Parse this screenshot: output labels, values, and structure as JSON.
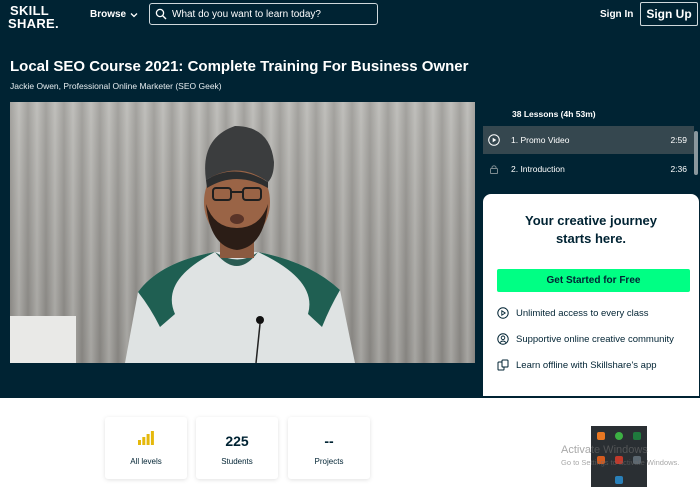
{
  "nav": {
    "logo_line1": "SKILL",
    "logo_line2": "SHARE.",
    "browse_label": "Browse",
    "search_placeholder": "What do you want to learn today?",
    "signin_label": "Sign In",
    "signup_label": "Sign Up"
  },
  "course": {
    "title": "Local SEO Course 2021: Complete Training For Business Owner",
    "author": "Jackie Owen, Professional Online Marketer (SEO Geek)"
  },
  "lessons": {
    "header": "38 Lessons (4h 53m)",
    "items": [
      {
        "name": "1. Promo Video",
        "duration": "2:59",
        "icon": "play-icon"
      },
      {
        "name": "2. Introduction",
        "duration": "2:36",
        "icon": "lock-icon"
      }
    ]
  },
  "card": {
    "headline_line1": "Your creative journey",
    "headline_line2": "starts here.",
    "cta_label": "Get Started for Free",
    "features": [
      {
        "text": "Unlimited access to every class",
        "icon": "play-circle-icon"
      },
      {
        "text": "Supportive online creative community",
        "icon": "user-icon"
      },
      {
        "text": "Learn offline with Skillshare's app",
        "icon": "devices-icon"
      }
    ]
  },
  "stats": [
    {
      "value": "",
      "label": "All levels",
      "icon": "level-bars-icon"
    },
    {
      "value": "225",
      "label": "Students"
    },
    {
      "value": "--",
      "label": "Projects"
    }
  ],
  "windows": {
    "activate_title": "Activate Windows",
    "activate_sub": "Go to Settings to activate Windows."
  },
  "colors": {
    "hero_bg": "#002333",
    "cta_green": "#00ff84",
    "level_gold": "#e5b80b",
    "active_lesson": "#35474f"
  }
}
